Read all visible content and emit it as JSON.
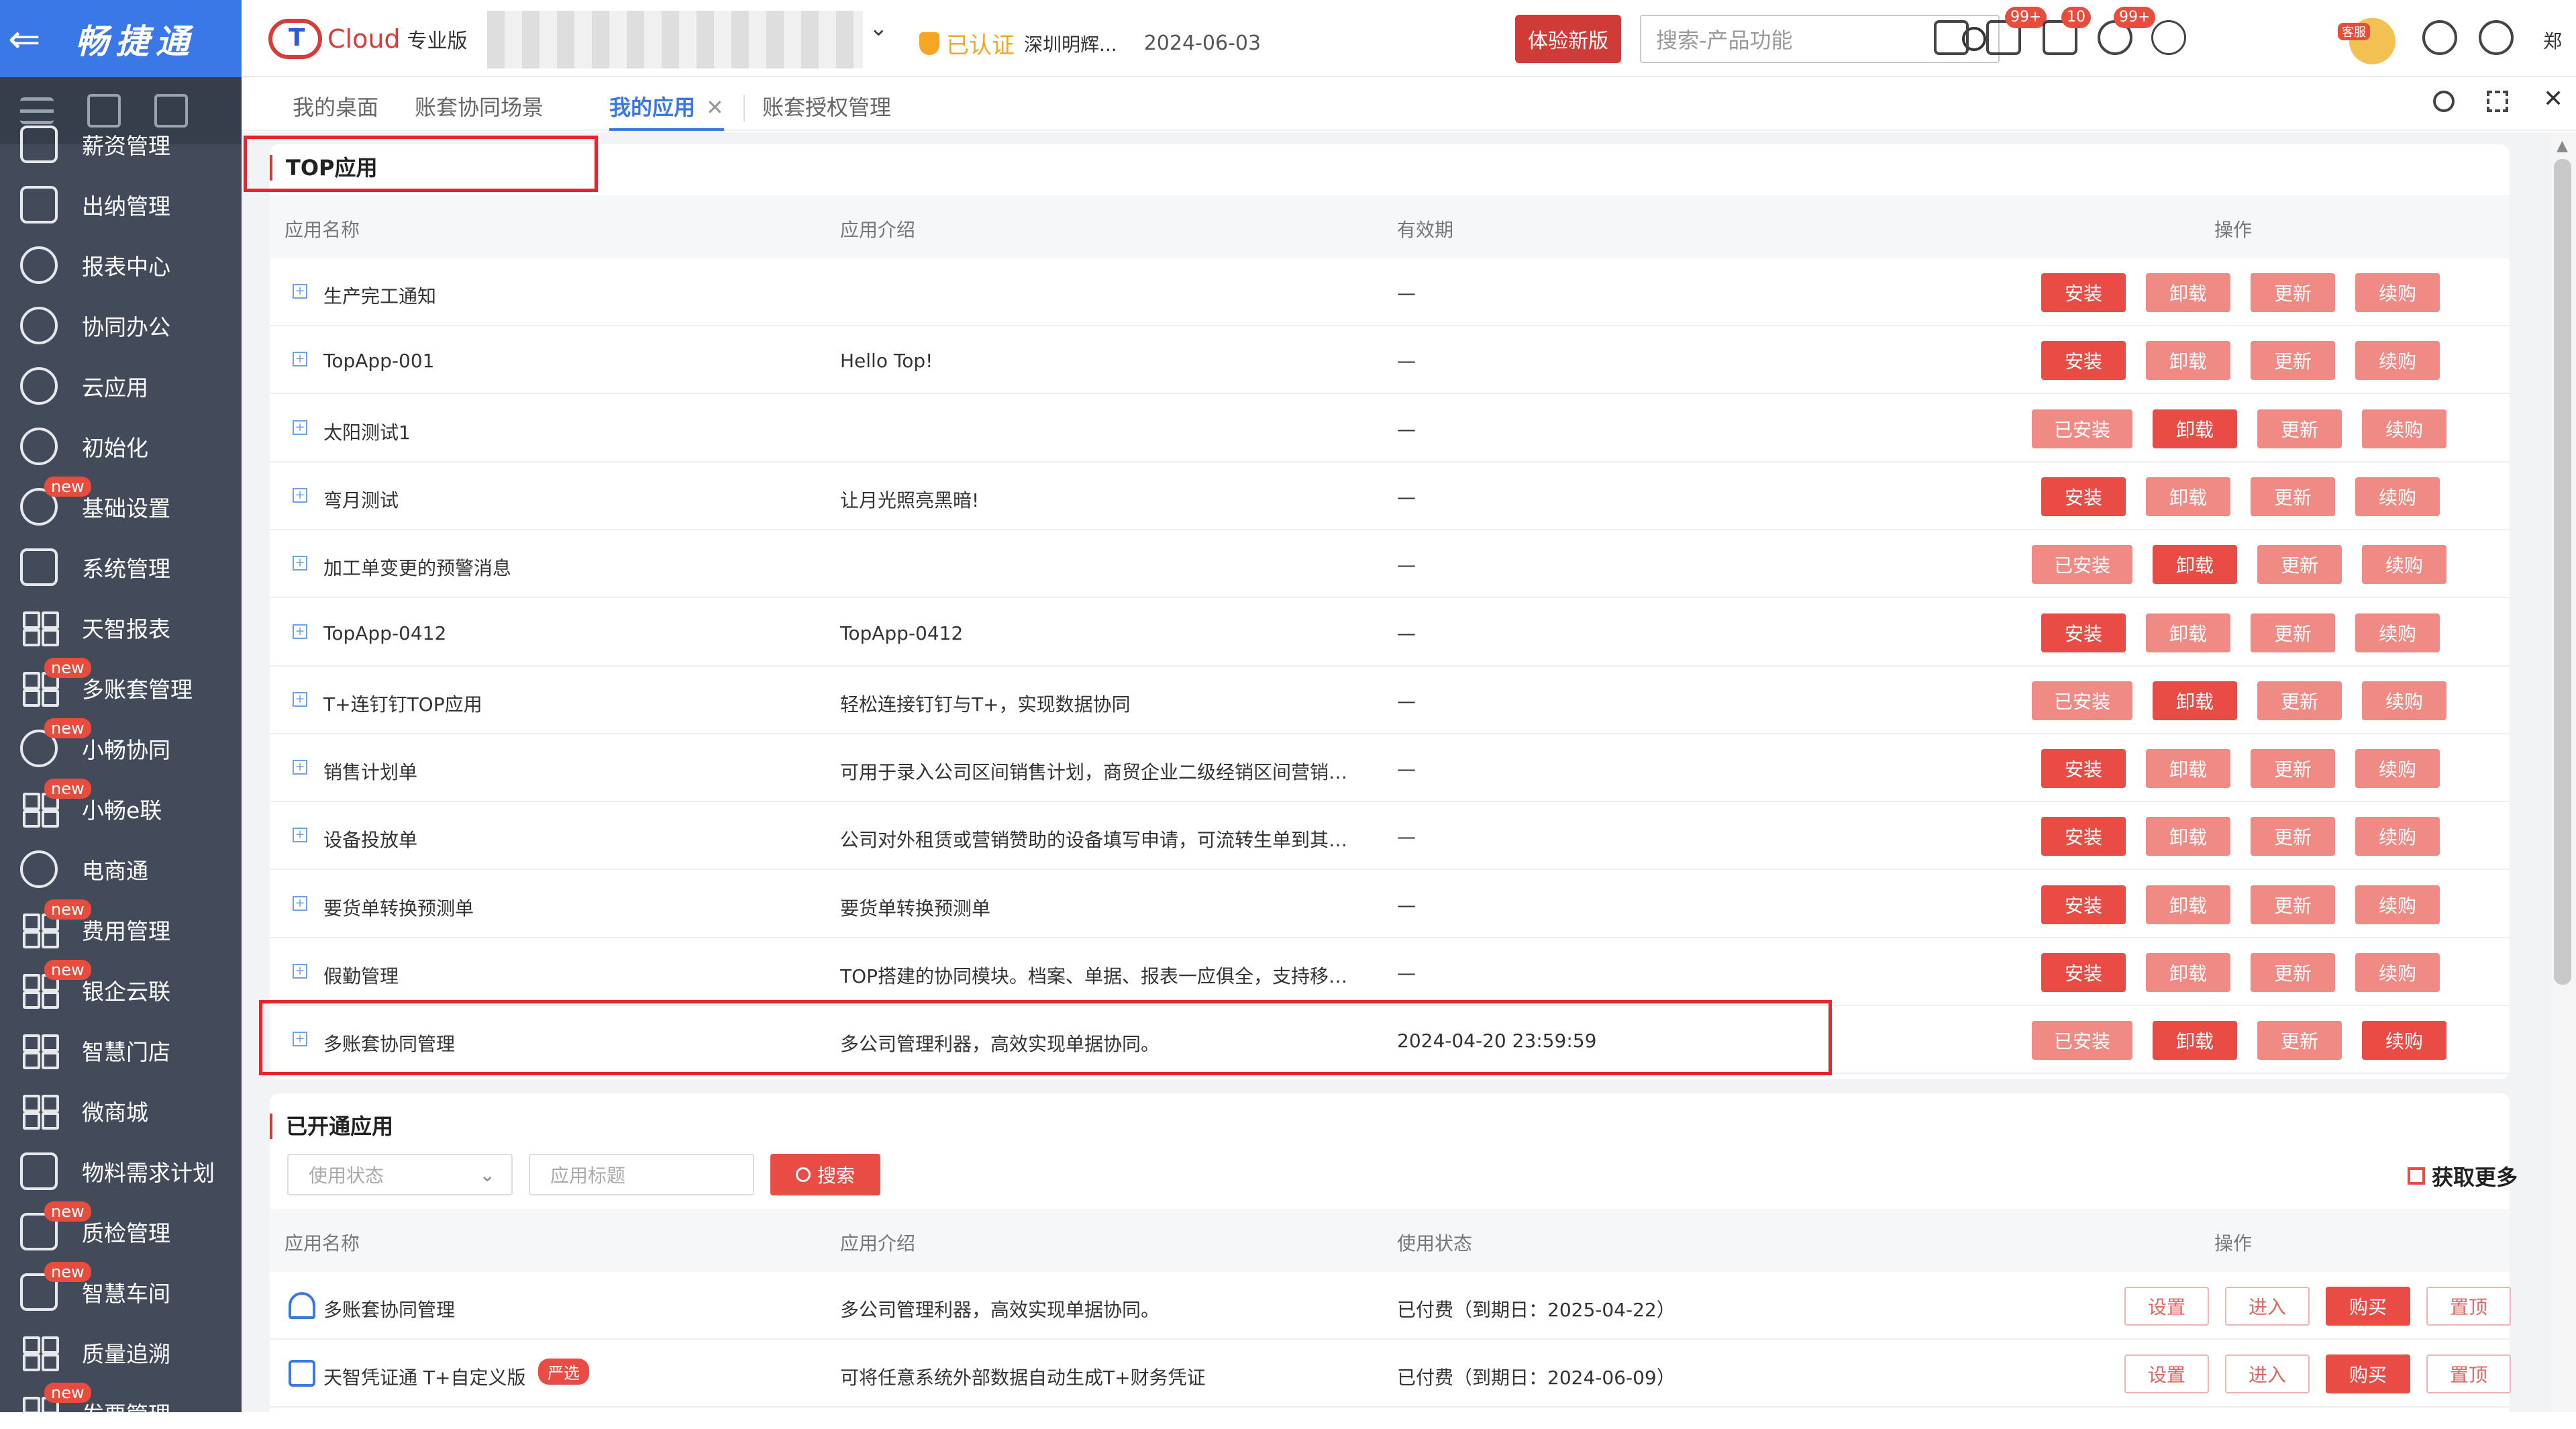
{
  "app": {
    "name": "畅捷通",
    "brand_cloud": "Cloud",
    "brand_edition": "专业版"
  },
  "header": {
    "certified_label": "已认证",
    "org_name": "深圳明辉...",
    "date": "2024-06-03",
    "try_button": "体验新版",
    "search_placeholder": "搜索-产品功能",
    "badges": {
      "tasks": "99+",
      "messages": "10",
      "notifications": "99+"
    },
    "mascot_label": "客服",
    "user_label": "郑"
  },
  "sidebar": {
    "items": [
      {
        "label": "薪资管理",
        "new": false
      },
      {
        "label": "出纳管理",
        "new": false
      },
      {
        "label": "报表中心",
        "new": false
      },
      {
        "label": "协同办公",
        "new": false
      },
      {
        "label": "云应用",
        "new": false
      },
      {
        "label": "初始化",
        "new": false
      },
      {
        "label": "基础设置",
        "new": true
      },
      {
        "label": "系统管理",
        "new": false
      },
      {
        "label": "天智报表",
        "new": false
      },
      {
        "label": "多账套管理",
        "new": true
      },
      {
        "label": "小畅协同",
        "new": true
      },
      {
        "label": "小畅e联",
        "new": true
      },
      {
        "label": "电商通",
        "new": false
      },
      {
        "label": "费用管理",
        "new": true
      },
      {
        "label": "银企云联",
        "new": true
      },
      {
        "label": "智慧门店",
        "new": false
      },
      {
        "label": "微商城",
        "new": false
      },
      {
        "label": "物料需求计划",
        "new": false
      },
      {
        "label": "质检管理",
        "new": true
      },
      {
        "label": "智慧车间",
        "new": true
      },
      {
        "label": "质量追溯",
        "new": false
      },
      {
        "label": "发票管理",
        "new": true
      }
    ],
    "new_tag": "new"
  },
  "tabs": [
    {
      "label": "我的桌面"
    },
    {
      "label": "账套协同场景"
    },
    {
      "label": "我的应用",
      "active": true
    },
    {
      "label": "账套授权管理"
    }
  ],
  "top_apps": {
    "title": "TOP应用",
    "columns": {
      "name": "应用名称",
      "desc": "应用介绍",
      "validity": "有效期",
      "ops": "操作"
    },
    "rows": [
      {
        "name": "生产完工通知",
        "desc": "",
        "validity": "—",
        "installed": false
      },
      {
        "name": "TopApp-001",
        "desc": "Hello Top!",
        "validity": "—",
        "installed": false
      },
      {
        "name": "太阳测试1",
        "desc": "",
        "validity": "—",
        "installed": true
      },
      {
        "name": "弯月测试",
        "desc": "让月光照亮黑暗!",
        "validity": "—",
        "installed": false
      },
      {
        "name": "加工单变更的预警消息",
        "desc": "",
        "validity": "—",
        "installed": true
      },
      {
        "name": "TopApp-0412",
        "desc": "TopApp-0412",
        "validity": "—",
        "installed": false
      },
      {
        "name": "T+连钉钉TOP应用",
        "desc": "轻松连接钉钉与T+，实现数据协同",
        "validity": "—",
        "installed": true
      },
      {
        "name": "销售计划单",
        "desc": "可用于录入公司区间销售计划，商贸企业二级经销区间营销目标...",
        "validity": "—",
        "installed": false
      },
      {
        "name": "设备投放单",
        "desc": "公司对外租赁或营销赞助的设备填写申请，可流转生单到其他出...",
        "validity": "—",
        "installed": false
      },
      {
        "name": "要货单转换预测单",
        "desc": "要货单转换预测单",
        "validity": "—",
        "installed": false
      },
      {
        "name": "假勤管理",
        "desc": "TOP搭建的协同模块。档案、单据、报表一应俱全，支持移动端...",
        "validity": "—",
        "installed": false
      },
      {
        "name": "多账套协同管理",
        "desc": "多公司管理利器，高效实现单据协同。",
        "validity": "2024-04-20 23:59:59",
        "installed": true
      }
    ],
    "btn_install": "安装",
    "btn_installed": "已安装",
    "btn_uninstall": "卸载",
    "btn_update": "更新",
    "btn_renew": "续购"
  },
  "opened_apps": {
    "title": "已开通应用",
    "filter_status_placeholder": "使用状态",
    "filter_title_placeholder": "应用标题",
    "search_button": "搜索",
    "more_link": "获取更多",
    "columns": {
      "name": "应用名称",
      "desc": "应用介绍",
      "status": "使用状态",
      "ops": "操作"
    },
    "rows": [
      {
        "name": "多账套协同管理",
        "tag": "",
        "desc": "多公司管理利器，高效实现单据协同。",
        "status": "已付费（到期日：2025-04-22）"
      },
      {
        "name": "天智凭证通 T+自定义版",
        "tag": "严选",
        "desc": "可将任意系统外部数据自动生成T+财务凭证",
        "status": "已付费（到期日：2024-06-09）"
      }
    ],
    "btn_settings": "设置",
    "btn_enter": "进入",
    "btn_buy": "购买",
    "btn_pin": "置顶"
  },
  "colors": {
    "accent_blue": "#3b78e7",
    "primary_red": "#e84c45",
    "nav_bg": "#434b5b"
  }
}
